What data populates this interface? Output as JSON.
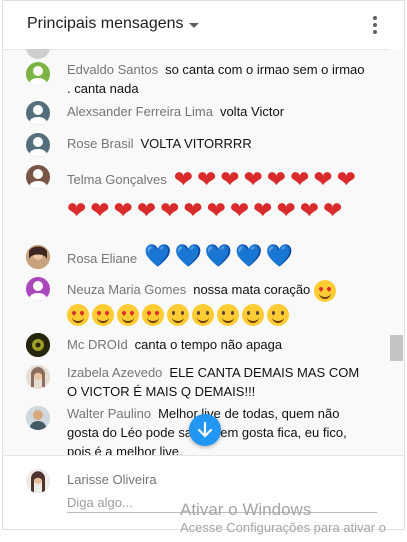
{
  "header": {
    "title": "Principais mensagens",
    "menu_icon": "more-vert-icon"
  },
  "messages": [
    {
      "author": "Edvaldo Santos",
      "text": "so canta com o irmao sem o irmao . canta nada",
      "avatar": "green-person-avatar"
    },
    {
      "author": "Alexsander Ferreira Lima",
      "text": "volta Victor",
      "avatar": "slate-person-avatar"
    },
    {
      "author": "Rose Brasil",
      "text": "VOLTA VITORRRR",
      "avatar": "slate-person-avatar"
    },
    {
      "author": "Telma Gonçalves",
      "text": "",
      "hearts": "❤❤❤❤❤❤❤❤❤❤❤❤❤❤❤❤❤❤❤❤",
      "avatar": "brown-person-avatar"
    },
    {
      "author": "Rosa Eliane",
      "text": "",
      "hearts": "💙💙💙💙💙",
      "avatar": "photo-avatar"
    },
    {
      "author": "Neuza Maria Gomes",
      "text": "nossa mata coração",
      "avatar": "purple-person-avatar"
    },
    {
      "author": "Mc DROId",
      "text": "canta o tempo não apaga",
      "avatar": "dark-photo-avatar"
    },
    {
      "author": "Izabela Azevedo",
      "text": "ELE CANTA DEMAIS MAS COM O VICTOR É MAIS Q DEMAIS!!!",
      "avatar": "photo-avatar"
    },
    {
      "author": "Walter Paulino",
      "text": "Melhor live de todas, quem não gosta do Léo pode sair, quem gosta fica, eu fico, pois é a melhor live.",
      "avatar": "photo-avatar"
    }
  ],
  "input": {
    "user": "Larisse Oliveira",
    "placeholder": "Diga algo..."
  },
  "watermark": {
    "title": "Ativar o Windows",
    "subtitle": "Acesse Configurações para ativar o"
  },
  "icons": {
    "jump": "arrow-down-icon",
    "dropdown": "caret-down-icon"
  }
}
